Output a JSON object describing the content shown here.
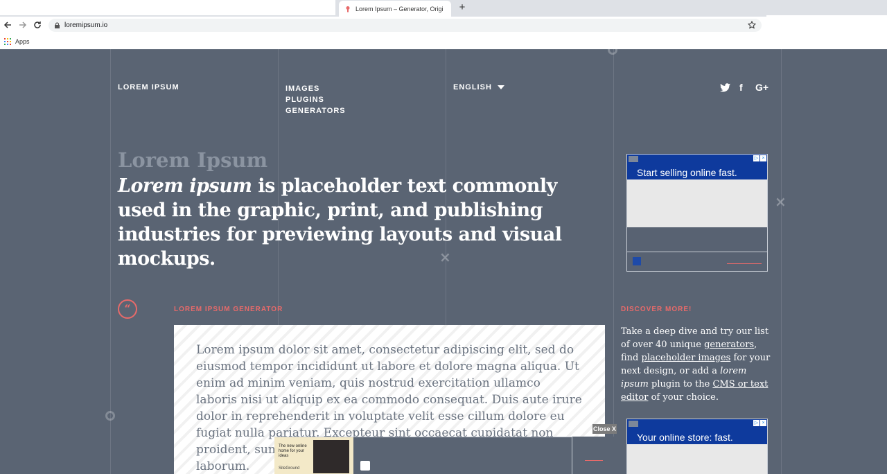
{
  "browser": {
    "tab_title": "Lorem Ipsum – Generator, Origi",
    "new_tab_symbol": "+",
    "url": "loremipsum.io",
    "bookmarks_apps": "Apps"
  },
  "site": {
    "brand": "LOREM IPSUM",
    "menu": [
      "IMAGES",
      "PLUGINS",
      "GENERATORS"
    ],
    "language": "ENGLISH",
    "social": {
      "twitter": "🐦",
      "facebook": "f",
      "google": "G+"
    }
  },
  "hero": {
    "small_title": "Lorem Ipsum",
    "lead_italic": "Lorem ipsum",
    "lead_rest": " is placeholder text commonly used in the graphic, print, and publishing industries for previewing layouts and visual mockups."
  },
  "generator": {
    "label": "LOREM IPSUM GENERATOR",
    "quote_glyph": "“",
    "text": "Lorem ipsum dolor sit amet, consectetur adipiscing elit, sed do eiusmod tempor incididunt ut labore et dolore magna aliqua. Ut enim ad minim veniam, quis nostrud exercitation ullamco laboris nisi ut aliquip ex ea commodo consequat. Duis aute irure dolor in reprehenderit in voluptate velit esse cillum dolore eu fugiat nulla pariatur. Excepteur sint occaecat cupidatat non proident, sunt in culpa qui officia deserunt mollit anim id est laborum."
  },
  "discover": {
    "label": "DISCOVER MORE!",
    "t1": "Take a deep dive and try our list of over 40 unique ",
    "link_generators": "generators",
    "t2": ", find ",
    "link_images": "placeholder images",
    "t3": " for your next design, or add a ",
    "italic": "lorem ipsum",
    "t4": " plugin to the ",
    "link_cms": "CMS or text editor",
    "t5": " of your choice."
  },
  "ads": {
    "ad1_text": "Start selling online fast.",
    "ad2_text": "Your online store: fast.",
    "close_label": "Close X",
    "mini_ad_text": "The new online home for your ideas",
    "mini_ad_logo": "SiteGround"
  },
  "colors": {
    "page_bg": "#5a6473",
    "accent": "#e86a6a",
    "ad_blue": "#0e3a9d"
  }
}
